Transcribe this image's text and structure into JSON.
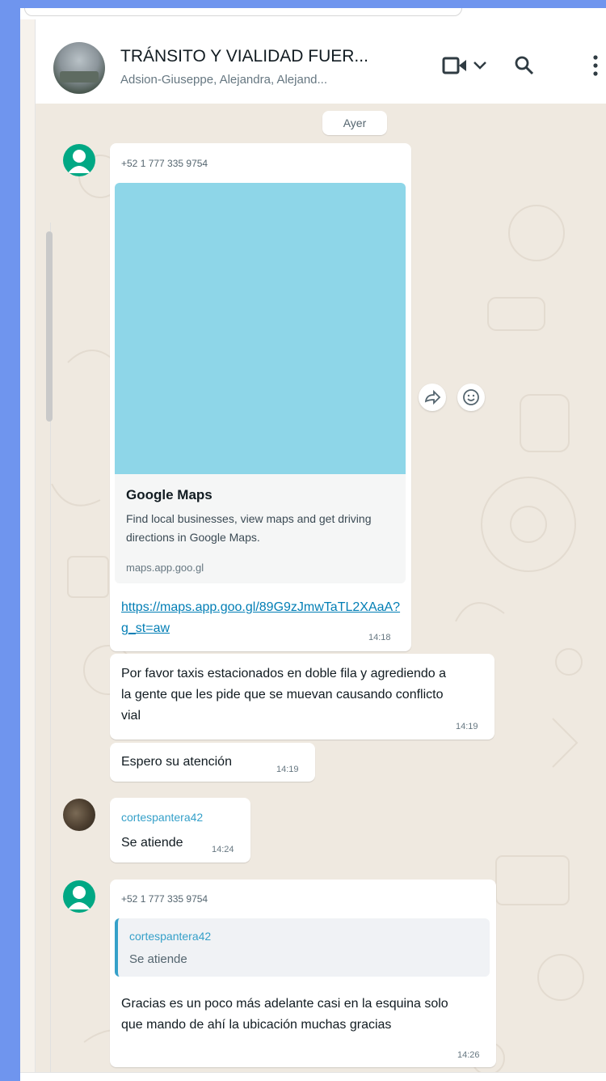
{
  "header": {
    "title": "TRÁNSITO Y VIALIDAD FUER...",
    "subtitle": "Adsion-Giuseppe, Alejandra, Alejand..."
  },
  "day_divider": "Ayer",
  "messages": [
    {
      "sender": "+52 1 777 335 9754",
      "link_preview": {
        "title": "Google Maps",
        "description": "Find local businesses, view maps and get driving directions in Google Maps.",
        "domain": "maps.app.goo.gl"
      },
      "link": "https://maps.app.goo.gl/89G9zJmwTaTL2XAaA?g_st=aw",
      "time": "14:18"
    },
    {
      "text": "Por favor taxis estacionados en doble fila y agrediendo a la gente que les pide que se muevan causando conflicto vial",
      "time": "14:19"
    },
    {
      "text": "Espero su atención",
      "time": "14:19"
    },
    {
      "sender": "cortespantera42",
      "text": "Se atiende",
      "time": "14:24"
    },
    {
      "sender": "+52 1 777 335 9754",
      "quote": {
        "sender": "cortespantera42",
        "text": "Se atiende"
      },
      "text": "Gracias es un poco más adelante casi en la esquina solo que mando de ahí la ubicación muchas gracias",
      "time": "14:26"
    }
  ],
  "icons": {
    "video": "video-call-icon",
    "dropdown": "chevron-down-icon",
    "search": "search-icon",
    "menu": "more-vertical-icon",
    "forward": "forward-icon",
    "react": "emoji-icon"
  },
  "colors": {
    "link": "#027eb5",
    "sender_name": "#35a0c9",
    "avatar_default": "#00a884",
    "map_preview": "#8ed6e8"
  }
}
